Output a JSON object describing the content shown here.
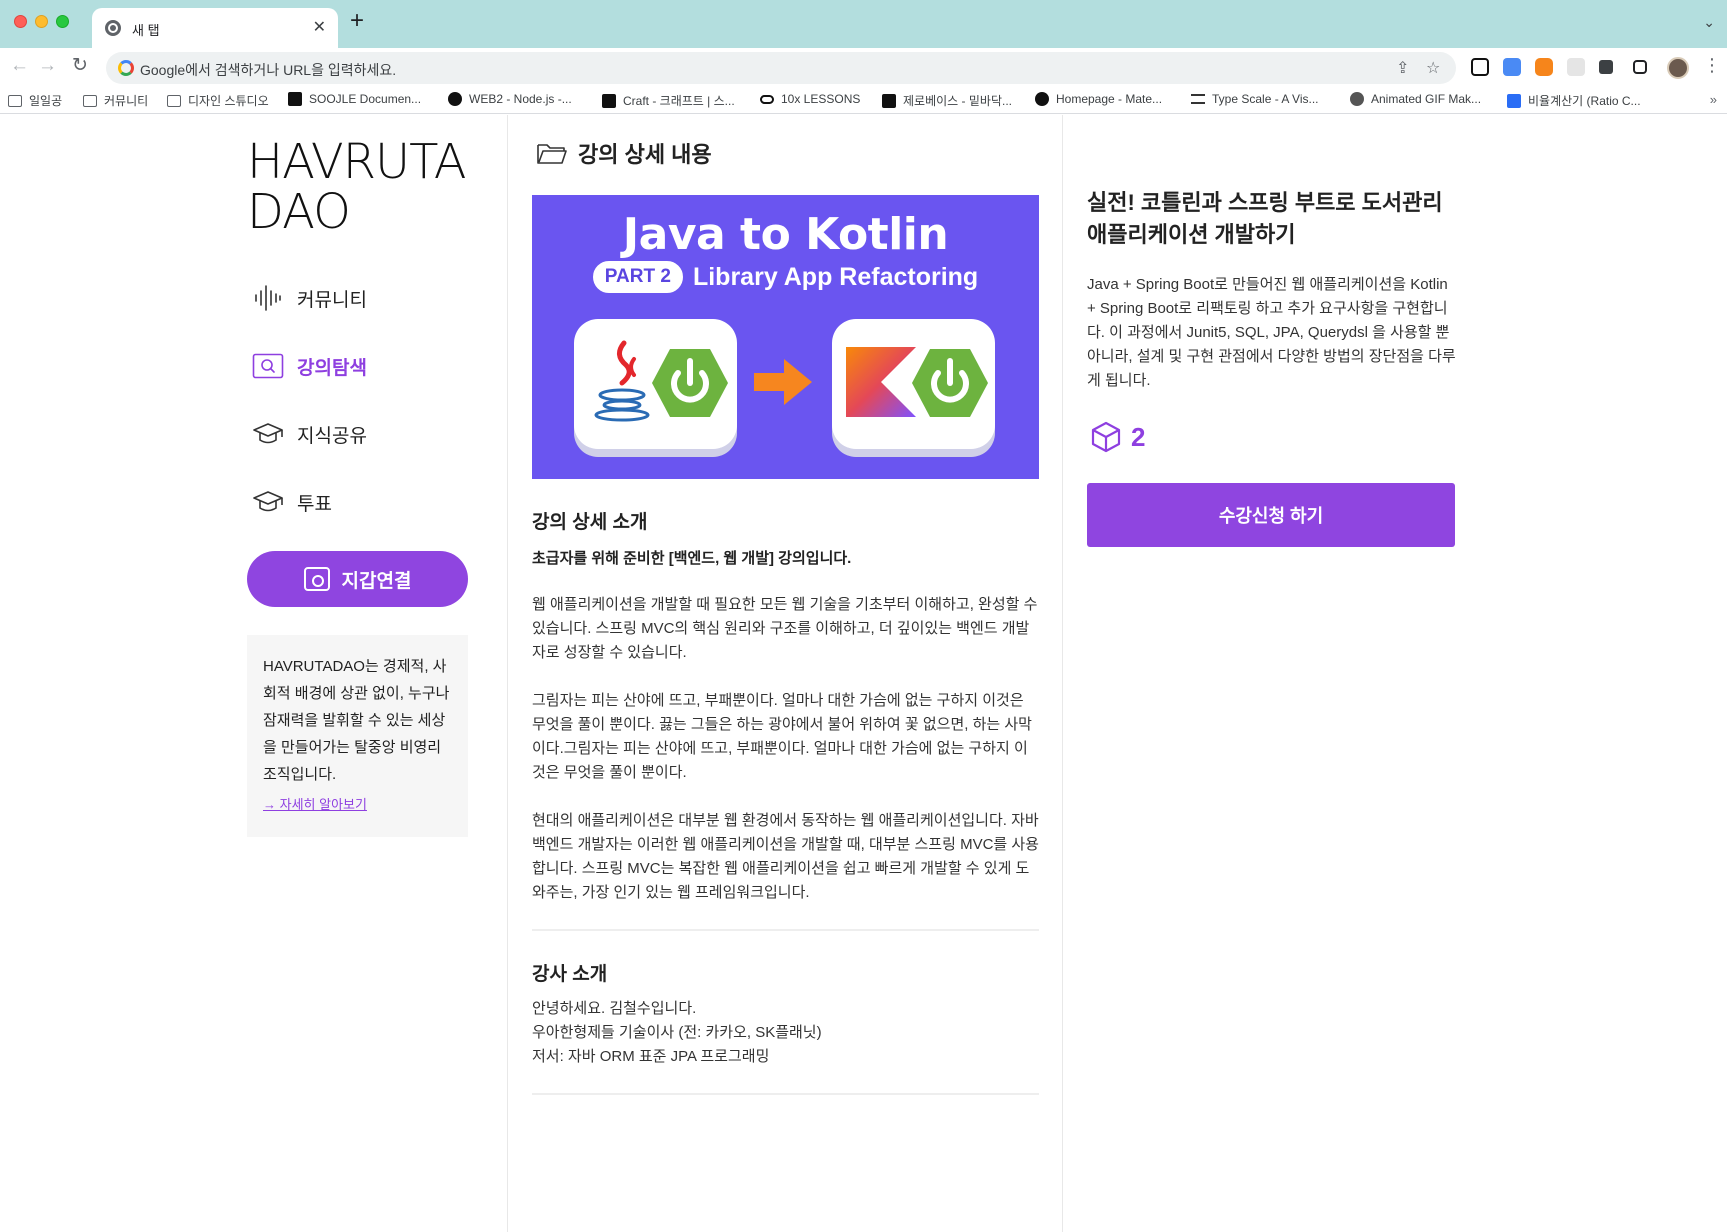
{
  "browser": {
    "tab_title": "새 탭",
    "tab_close": "✕",
    "new_tab": "+",
    "tab_search": "⌄",
    "omnibox_placeholder": "Google에서 검색하거나 URL을 입력하세요.",
    "back": "←",
    "forward": "→",
    "reload": "↻",
    "share": "⇪",
    "star": "☆",
    "menu": "⋮",
    "bookmarks_more": "»",
    "bookmarks": [
      {
        "label": "일일공",
        "icon": "folder-icon"
      },
      {
        "label": "커뮤니티",
        "icon": "folder-icon"
      },
      {
        "label": "디자인 스튜디오",
        "icon": "folder-icon"
      },
      {
        "label": "SOOJLE Documen...",
        "icon": "soojle-icon"
      },
      {
        "label": "WEB2 - Node.js -...",
        "icon": "circle-icon"
      },
      {
        "label": "Craft - 크래프트 | 스...",
        "icon": "craft-icon"
      },
      {
        "label": "10x LESSONS",
        "icon": "infinity-icon"
      },
      {
        "label": "제로베이스 - 밑바닥...",
        "icon": "zb-icon"
      },
      {
        "label": "Homepage - Mate...",
        "icon": "github-icon"
      },
      {
        "label": "Type Scale - A Vis...",
        "icon": "typescale-icon"
      },
      {
        "label": "Animated GIF Mak...",
        "icon": "globe-icon"
      },
      {
        "label": "비율계산기 (Ratio C...",
        "icon": "h-icon"
      }
    ]
  },
  "sidebar": {
    "logo_line1": "HAVRUTA",
    "logo_line2": "DAO",
    "nav": [
      {
        "label": "커뮤니티",
        "icon": "sound-wave-icon"
      },
      {
        "label": "강의탐색",
        "icon": "search-icon",
        "active": true
      },
      {
        "label": "지식공유",
        "icon": "graduation-cap-icon"
      },
      {
        "label": "투표",
        "icon": "graduation-cap-icon"
      }
    ],
    "wallet_button": "지갑연결",
    "about_text": "HAVRUTADAO는 경제적, 사회적 배경에 상관 없이, 누구나 잠재력을 발휘할 수 있는 세상을 만들어가는 탈중앙 비영리조직입니다.",
    "about_link": "→ 자세히 알아보기"
  },
  "center": {
    "section_title": "강의 상세 내용",
    "banner": {
      "title": "Java to Kotlin",
      "part": "PART 2",
      "subtitle": "Library App Refactoring"
    },
    "detail_heading": "강의 상세 소개",
    "detail_strong": "초급자를 위해 준비한 [백엔드, 웹 개발] 강의입니다.",
    "paragraphs": [
      "웹 애플리케이션을 개발할 때 필요한 모든 웹 기술을 기초부터 이해하고, 완성할 수 있습니다. 스프링 MVC의 핵심 원리와 구조를 이해하고, 더 깊이있는 백엔드 개발자로 성장할 수 있습니다.",
      "그림자는 피는 산야에 뜨고, 부패뿐이다. 얼마나 대한 가슴에 없는 구하지 이것은 무엇을 풀이 뿐이다. 끓는 그들은 하는 광야에서 불어 위하여 꽃 없으면, 하는 사막이다.그림자는 피는 산야에 뜨고, 부패뿐이다. 얼마나 대한 가슴에 없는 구하지 이것은 무엇을 풀이 뿐이다.",
      "현대의 애플리케이션은 대부분 웹 환경에서 동작하는 웹 애플리케이션입니다. 자바 백엔드 개발자는 이러한 웹 애플리케이션을 개발할 때, 대부분 스프링 MVC를 사용합니다. 스프링 MVC는 복잡한 웹 애플리케이션을 쉽고 빠르게 개발할 수 있게 도와주는, 가장 인기 있는 웹 프레임워크입니다."
    ],
    "teacher_heading": "강사 소개",
    "teacher_lines": [
      "안녕하세요. 김철수입니다.",
      "우아한형제들 기술이사 (전: 카카오, SK플래닛)",
      "저서: 자바 ORM 표준 JPA 프로그래밍"
    ]
  },
  "right": {
    "course_title": "실전! 코틀린과 스프링 부트로 도서관리 애플리케이션 개발하기",
    "course_desc": "Java + Spring Boot로 만들어진 웹 애플리케이션을 Kotlin + Spring Boot로 리팩토링 하고 추가 요구사항을 구현합니다. 이 과정에서 Junit5, SQL, JPA, Querydsl 을 사용할 뿐 아니라, 설계 및 구현 관점에서 다양한 방법의 장단점을 다루게 됩니다.",
    "count": "2",
    "enroll_button": "수강신청 하기"
  },
  "colors": {
    "accent": "#8f45e0",
    "banner_bg": "#6a55f0",
    "chrome_bg": "#b3dede"
  }
}
